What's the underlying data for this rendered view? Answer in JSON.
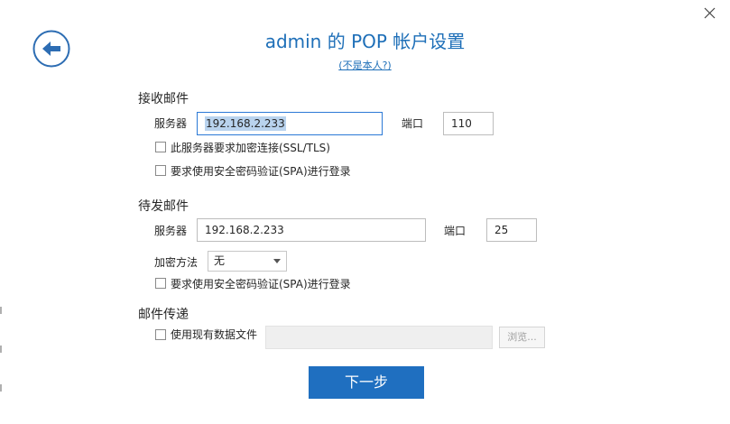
{
  "header": {
    "title": "admin 的 POP 帐户设置",
    "subtitle": "(不是本人?)"
  },
  "incoming": {
    "section_label": "接收邮件",
    "server_label": "服务器",
    "server_value": "192.168.2.233",
    "port_label": "端口",
    "port_value": "110",
    "ssl_label": "此服务器要求加密连接(SSL/TLS)",
    "spa_label": "要求使用安全密码验证(SPA)进行登录"
  },
  "outgoing": {
    "section_label": "待发邮件",
    "server_label": "服务器",
    "server_value": "192.168.2.233",
    "port_label": "端口",
    "port_value": "25",
    "encryption_label": "加密方法",
    "encryption_value": "无",
    "spa_label": "要求使用安全密码验证(SPA)进行登录"
  },
  "delivery": {
    "section_label": "邮件传递",
    "existing_file_label": "使用现有数据文件",
    "browse_label": "浏览..."
  },
  "footer": {
    "next_label": "下一步"
  },
  "colors": {
    "accent": "#1e6fb8",
    "primary_button": "#1f6fc0",
    "focus_border": "#2b79d6",
    "selection": "#b9d3ee"
  },
  "icons": {
    "back": "back-arrow-icon",
    "close": "close-icon",
    "dropdown": "chevron-down-icon"
  }
}
